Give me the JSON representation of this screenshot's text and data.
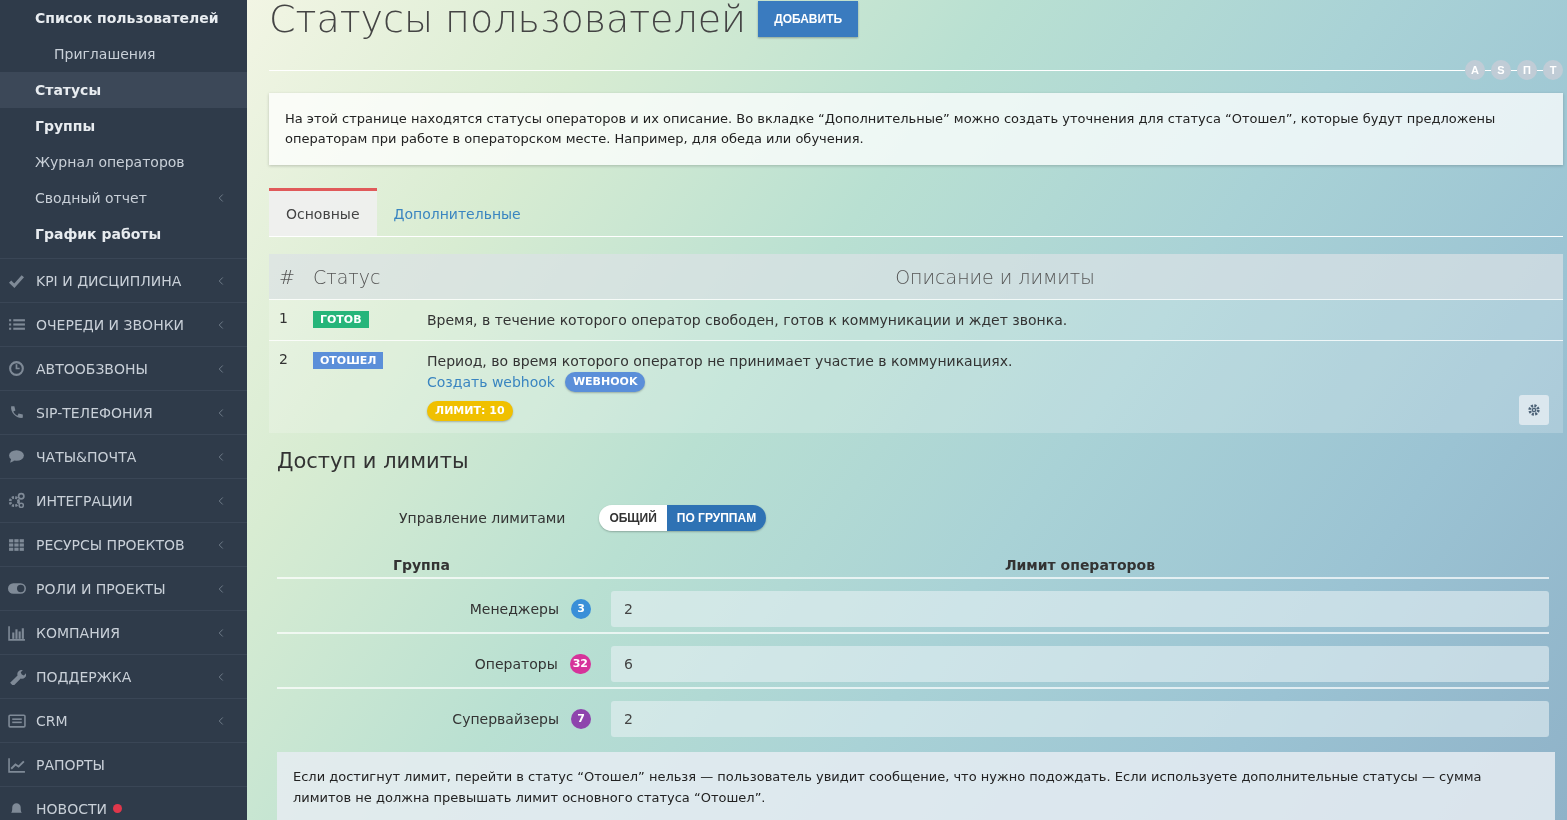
{
  "sidebar": {
    "sub_items": [
      {
        "label": "Список пользователей",
        "bold": true,
        "indented": false,
        "selected": false,
        "has_children": false
      },
      {
        "label": "Приглашения",
        "bold": false,
        "indented": true,
        "selected": false,
        "has_children": false
      },
      {
        "label": "Статусы",
        "bold": true,
        "indented": false,
        "selected": true,
        "has_children": false
      },
      {
        "label": "Группы",
        "bold": true,
        "indented": false,
        "selected": false,
        "has_children": false
      },
      {
        "label": "Журнал операторов",
        "bold": false,
        "indented": false,
        "selected": false,
        "has_children": false
      },
      {
        "label": "Сводный отчет",
        "bold": false,
        "indented": false,
        "selected": false,
        "has_children": true
      },
      {
        "label": "График работы",
        "bold": true,
        "indented": false,
        "selected": false,
        "has_children": false
      }
    ],
    "items": [
      {
        "kind": "check",
        "label": "KPI И ДИСЦИПЛИНА",
        "has_children": true,
        "notification": false
      },
      {
        "kind": "list",
        "label": "ОЧЕРЕДИ И ЗВОНКИ",
        "has_children": true,
        "notification": false
      },
      {
        "kind": "clock",
        "label": "АВТООБЗВОНЫ",
        "has_children": true,
        "notification": false
      },
      {
        "kind": "phone",
        "label": "SIP-ТЕЛЕФОНИЯ",
        "has_children": true,
        "notification": false
      },
      {
        "kind": "chat",
        "label": "ЧАТЫ&ПОЧТА",
        "has_children": true,
        "notification": false
      },
      {
        "kind": "gears",
        "label": "ИНТЕГРАЦИИ",
        "has_children": true,
        "notification": false
      },
      {
        "kind": "grid",
        "label": "РЕСУРСЫ ПРОЕКТОВ",
        "has_children": true,
        "notification": false
      },
      {
        "kind": "toggle",
        "label": "РОЛИ И ПРОЕКТЫ",
        "has_children": true,
        "notification": false
      },
      {
        "kind": "bars",
        "label": "КОМПАНИЯ",
        "has_children": true,
        "notification": false
      },
      {
        "kind": "wrench",
        "label": "ПОДДЕРЖКА",
        "has_children": true,
        "notification": false
      },
      {
        "kind": "card",
        "label": "CRM",
        "has_children": true,
        "notification": false
      },
      {
        "kind": "chart",
        "label": "РАПОРТЫ",
        "has_children": false,
        "notification": false
      },
      {
        "kind": "bell",
        "label": "НОВОСТИ",
        "has_children": false,
        "notification": true
      }
    ]
  },
  "page": {
    "title": "Статусы пользователей",
    "add_button": "ДОБАВИТЬ",
    "steps": [
      "A",
      "S",
      "П",
      "T"
    ],
    "info": "На этой странице находятся статусы операторов и их описание. Во вкладке “Дополнительные” можно создать уточнения для статуса “Отошел”, которые будут предложены операторам при работе в операторском месте. Например, для обеда или обучения.",
    "tabs": [
      {
        "label": "Основные",
        "selected": true
      },
      {
        "label": "Дополнительные",
        "selected": false
      }
    ],
    "table": {
      "columns": [
        "#",
        "Статус",
        "Описание и лимиты"
      ],
      "rows": [
        {
          "number": "1",
          "status": "ГОТОВ",
          "color": "#26b57a",
          "description": "Время, в течение которого оператор свободен, готов к коммуникации и ждет звонка."
        },
        {
          "number": "2",
          "status": "ОТОШЕЛ",
          "color": "#5b8fd9",
          "description": "Период, во время которого оператор не принимает участие в коммуникациях.",
          "webhook_link": "Создать webhook",
          "webhook_badge": "WEBHOOK",
          "limit": "ЛИМИТ: 10",
          "settings": true
        }
      ]
    },
    "access": {
      "title": "Доступ и лимиты",
      "mode_label": "Управление лимитами",
      "modes": [
        {
          "label": "ОБЩИЙ",
          "selected": false
        },
        {
          "label": "ПО ГРУППАМ",
          "selected": true
        }
      ],
      "columns": [
        "Группа",
        "Лимит операторов"
      ],
      "groups": [
        {
          "name": "Менеджеры",
          "count": "3",
          "color": "#3a8fd8",
          "limit": "2"
        },
        {
          "name": "Операторы",
          "count": "32",
          "color": "#d6339a",
          "limit": "6"
        },
        {
          "name": "Супервайзеры",
          "count": "7",
          "color": "#8e44ad",
          "limit": "2"
        }
      ],
      "note": "Если достигнут лимит, перейти в статус “Отошел” нельзя — пользователь увидит сообщение, что нужно подождать. Если используете дополнительные статусы — сумма лимитов не должна превышать лимит основного статуса “Отошел”."
    }
  }
}
